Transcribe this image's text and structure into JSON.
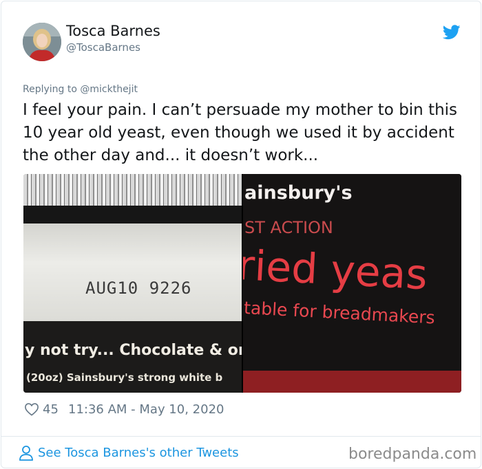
{
  "author": {
    "display_name": "Tosca Barnes",
    "handle": "@ToscaBarnes"
  },
  "tweet": {
    "reply_line": "Replying to @mickthejit",
    "text": "I feel your pain. I can’t persuade my mother to bin this 10 year old yeast, even though we used it by accident the other day and... it doesn’t work...",
    "likes": "45",
    "timestamp": "11:36 AM - May 10, 2020"
  },
  "media": {
    "left_photo": {
      "batch_code": "AUG10 9226",
      "promo_line_1": "y not try... Chocolate & or",
      "promo_line_2": "(20oz) Sainsbury's strong white b"
    },
    "right_photo": {
      "brand": "ainsbury's",
      "range": "ST ACTION",
      "product": "ried yeas",
      "usage": "table for breadmakers"
    }
  },
  "footer": {
    "see_tweets_link": "See Tosca Barnes's other Tweets",
    "watermark": "boredpanda.com"
  },
  "icons": {
    "bird": "twitter-bird-icon",
    "heart": "heart-icon",
    "person": "person-icon"
  },
  "colors": {
    "accent": "#1da1f2",
    "link": "#1b95e0",
    "muted": "#657786"
  }
}
